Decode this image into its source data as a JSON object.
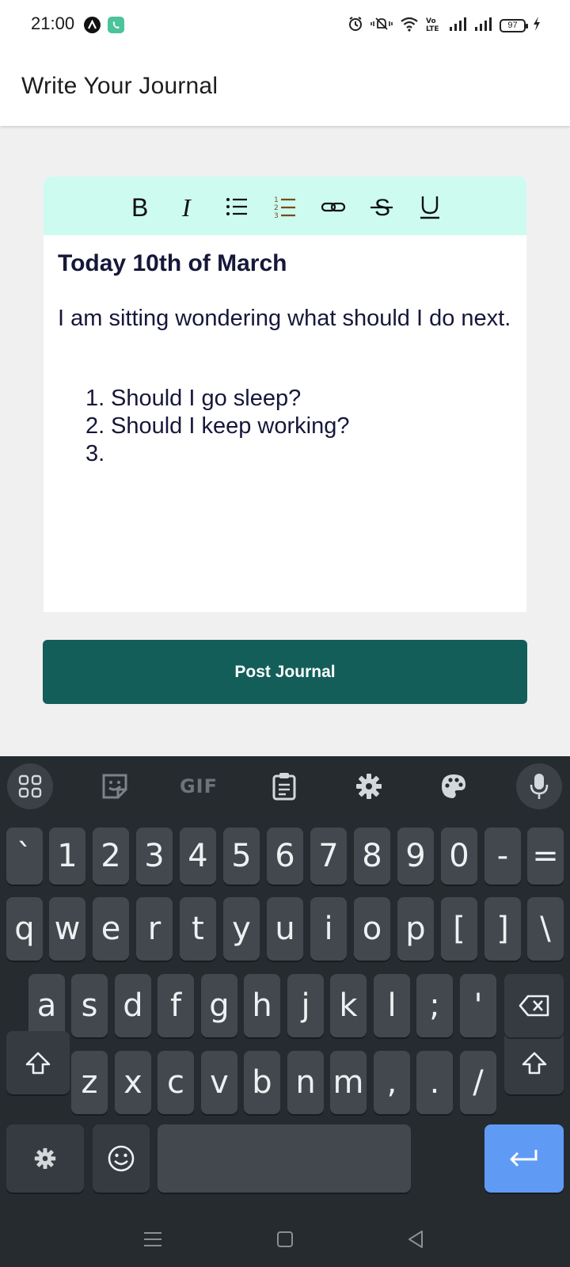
{
  "status_bar": {
    "time": "21:00",
    "battery": "97",
    "icons": [
      "alarm-icon",
      "mute-icon",
      "wifi-icon",
      "volte-icon",
      "signal-icon",
      "signal-icon",
      "battery-icon",
      "charging-icon"
    ]
  },
  "app_bar": {
    "title": "Write Your Journal"
  },
  "editor": {
    "toolbar": [
      "bold-icon",
      "italic-icon",
      "bulleted-list-icon",
      "numbered-list-icon",
      "link-icon",
      "strikethrough-icon",
      "underline-icon"
    ],
    "heading": "Today 10th of March",
    "paragraph": "I am sitting wondering what should I do next.",
    "list": [
      {
        "num": "1.",
        "text": "Should I go sleep?"
      },
      {
        "num": "2.",
        "text": "Should I keep working?"
      },
      {
        "num": "3.",
        "text": ""
      }
    ]
  },
  "post_button": {
    "label": "Post Journal"
  },
  "keyboard": {
    "toolbar": [
      "apps-grid-icon",
      "sticker-icon",
      "GIF",
      "clipboard-icon",
      "settings-icon",
      "palette-icon",
      "microphone-icon"
    ],
    "row_numbers": [
      "`",
      "1",
      "2",
      "3",
      "4",
      "5",
      "6",
      "7",
      "8",
      "9",
      "0",
      "-",
      "="
    ],
    "row_q": [
      "q",
      "w",
      "e",
      "r",
      "t",
      "y",
      "u",
      "i",
      "o",
      "p",
      "[",
      "]",
      "\\"
    ],
    "row_a": [
      "a",
      "s",
      "d",
      "f",
      "g",
      "h",
      "j",
      "k",
      "l",
      ";",
      "'"
    ],
    "row_z": [
      "z",
      "x",
      "c",
      "v",
      "b",
      "n",
      "m",
      ",",
      ".",
      "/"
    ]
  },
  "colors": {
    "toolbar_bg": "#cdfbef",
    "post_button_bg": "#135e59",
    "keyboard_bg": "#262b30",
    "enter_key": "#5f9bf5"
  }
}
